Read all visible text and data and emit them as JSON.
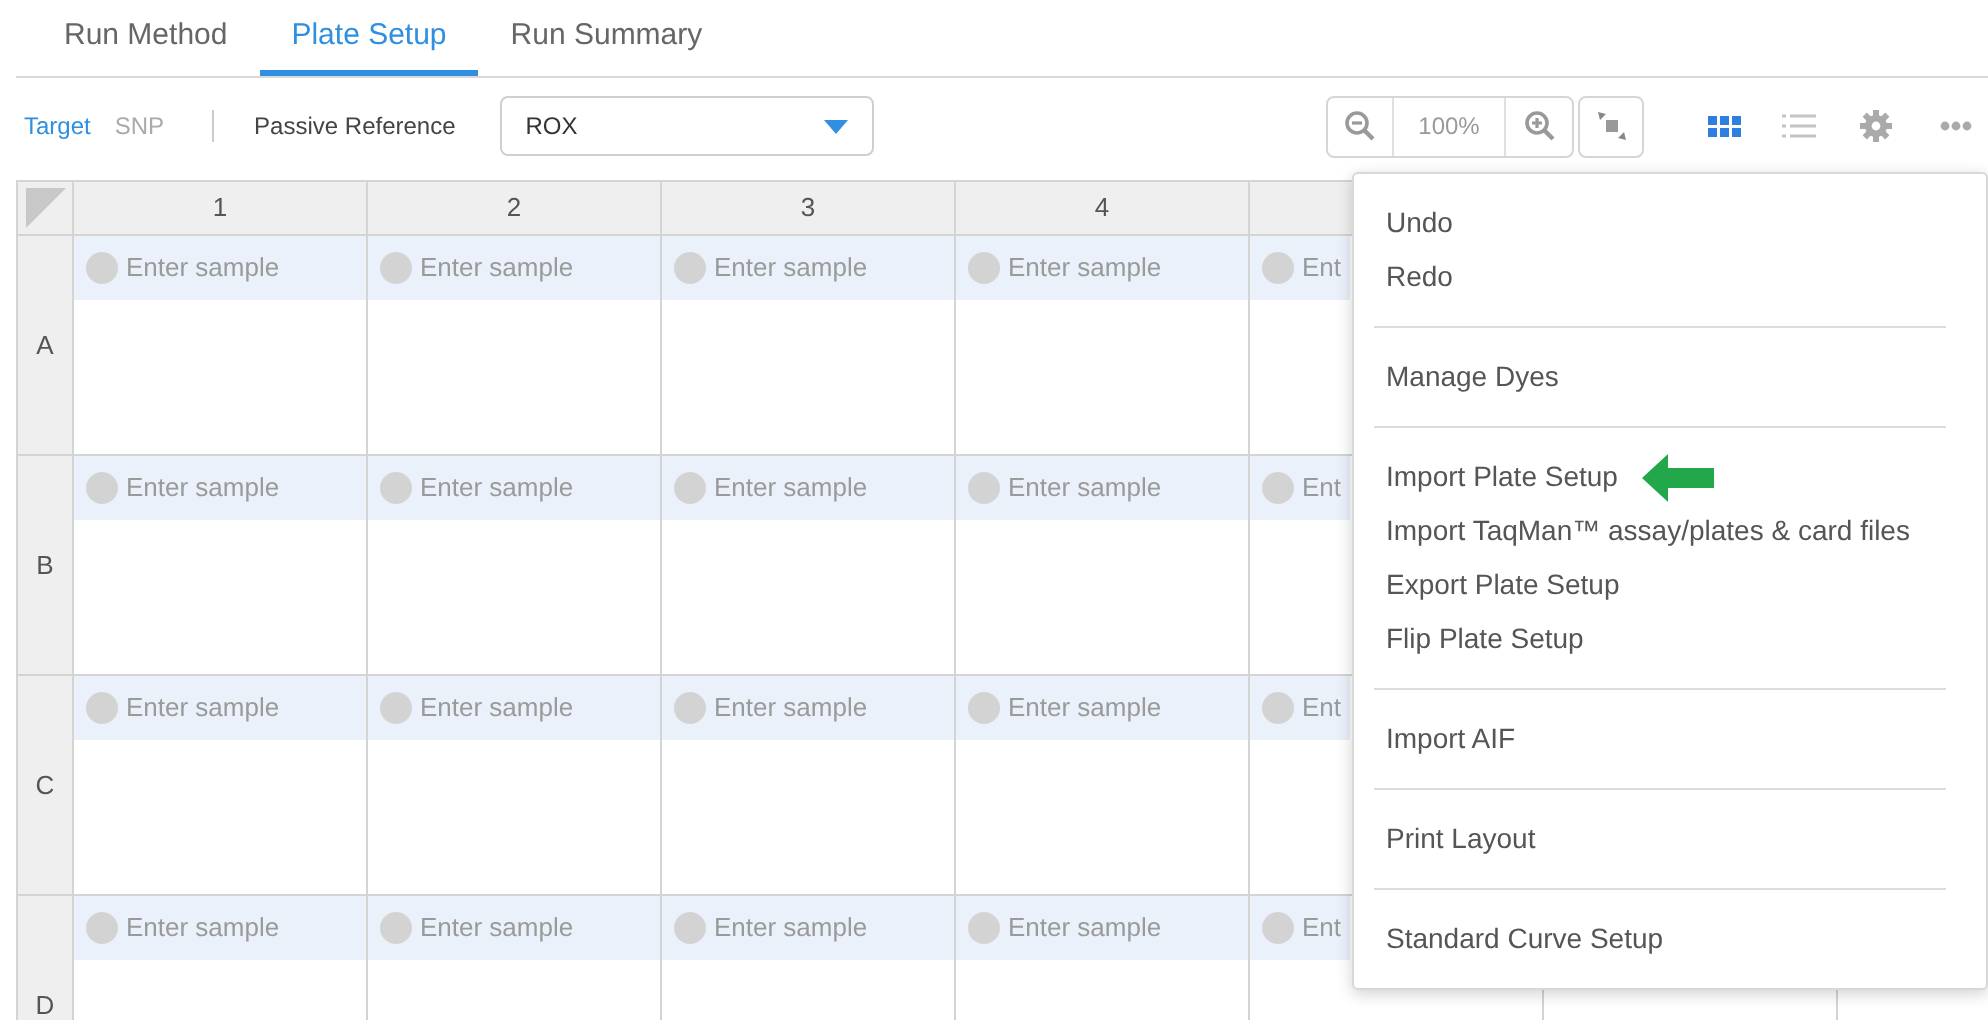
{
  "tabs": [
    {
      "label": "Run Method",
      "selected": false
    },
    {
      "label": "Plate Setup",
      "selected": true
    },
    {
      "label": "Run Summary",
      "selected": false
    }
  ],
  "toolbar": {
    "views": [
      {
        "label": "Target",
        "selected": true
      },
      {
        "label": "SNP",
        "selected": false
      }
    ],
    "passive_reference": {
      "label": "Passive Reference",
      "value": "ROX"
    },
    "zoom": "100%",
    "layouts": [
      {
        "kind": "grid",
        "selected": true
      },
      {
        "kind": "list",
        "selected": false
      }
    ]
  },
  "plate": {
    "columns": [
      "1",
      "2",
      "3",
      "4"
    ],
    "rows": [
      {
        "label": "A",
        "cells": [
          {
            "placeholder": "Enter sample"
          },
          {
            "placeholder": "Enter sample"
          },
          {
            "placeholder": "Enter sample"
          },
          {
            "placeholder": "Enter sample"
          },
          {
            "placeholder": "Ent"
          }
        ]
      },
      {
        "label": "B",
        "cells": [
          {
            "placeholder": "Enter sample"
          },
          {
            "placeholder": "Enter sample"
          },
          {
            "placeholder": "Enter sample"
          },
          {
            "placeholder": "Enter sample"
          },
          {
            "placeholder": "Ent"
          }
        ]
      },
      {
        "label": "C",
        "cells": [
          {
            "placeholder": "Enter sample"
          },
          {
            "placeholder": "Enter sample"
          },
          {
            "placeholder": "Enter sample"
          },
          {
            "placeholder": "Enter sample"
          },
          {
            "placeholder": "Ent"
          }
        ]
      },
      {
        "label": "D",
        "cells": [
          {
            "placeholder": "Enter sample"
          },
          {
            "placeholder": "Enter sample"
          },
          {
            "placeholder": "Enter sample"
          },
          {
            "placeholder": "Enter sample"
          },
          {
            "placeholder": "Ent"
          }
        ]
      }
    ]
  },
  "menu": {
    "groups": [
      [
        {
          "label": "Undo",
          "arrow": false
        },
        {
          "label": "Redo",
          "arrow": false
        }
      ],
      [
        {
          "label": "Manage Dyes",
          "arrow": false
        }
      ],
      [
        {
          "label": "Import Plate Setup",
          "arrow": true
        },
        {
          "label": "Import TaqMan™ assay/plates & card files",
          "arrow": false
        },
        {
          "label": "Export Plate Setup",
          "arrow": false
        },
        {
          "label": "Flip Plate Setup",
          "arrow": false
        }
      ],
      [
        {
          "label": "Import AIF",
          "arrow": false
        }
      ],
      [
        {
          "label": "Print Layout",
          "arrow": false
        }
      ],
      [
        {
          "label": "Standard Curve Setup",
          "arrow": false
        }
      ]
    ]
  }
}
